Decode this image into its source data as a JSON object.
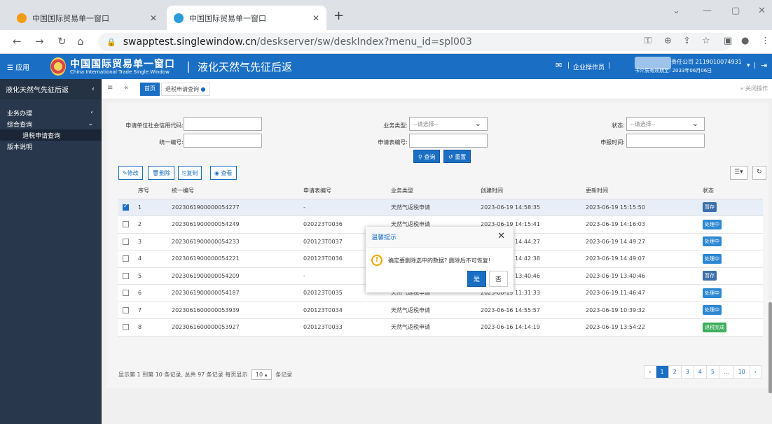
{
  "browser": {
    "tabs": [
      {
        "title": "中国国际贸易单一窗口",
        "active": false
      },
      {
        "title": "中国国际贸易单一窗口",
        "active": true
      }
    ],
    "url_host": "swapptest.singlewindow.cn",
    "url_path": "/deskserver/sw/deskIndex?menu_id=spl003"
  },
  "header": {
    "menu_label": "☰ 应用",
    "logo_cn": "中国国际贸易单一窗口",
    "logo_en": "China International Trade Single Window",
    "system_title": "液化天然气先征后返",
    "role": "企业操作员",
    "company": "责任公司 2119010074931",
    "cert_expiry": "卡介质有效期至: 2033年06月06日"
  },
  "sidebar": {
    "title": "液化天然气先征后返",
    "items": [
      {
        "label": "业务办理",
        "arrow": "‹"
      },
      {
        "label": "综合查询",
        "arrow": "⌄"
      },
      {
        "label": "退税申请查询",
        "arrow": ""
      },
      {
        "label": "版本说明",
        "arrow": ""
      }
    ]
  },
  "content_tabs": {
    "home": "首页",
    "current": "退税申请查询",
    "close_ops": "关闭操作"
  },
  "search": {
    "credit_code_label": "申请单位社会信用代码:",
    "unified_no_label": "统一编号:",
    "biz_type_label": "业务类型:",
    "biz_type_value": "--请选择--",
    "app_no_label": "申请表编号:",
    "status_label": "状态:",
    "status_value": "--请选择--",
    "report_time_label": "申报时间:",
    "query_btn": "查询",
    "reset_btn": "重置"
  },
  "toolbar": {
    "edit": "修改",
    "delete": "删除",
    "copy": "复制",
    "view": "查看"
  },
  "table": {
    "columns": [
      "序号",
      "统一编号",
      "申请表编号",
      "业务类型",
      "创建时间",
      "更新时间",
      "状态"
    ],
    "rows": [
      {
        "idx": "1",
        "uno": "2023061900000054277",
        "app": "-",
        "type": "天然气返税申请",
        "created": "2023-06-19 14:58:35",
        "updated": "2023-06-19 15:15:50",
        "status": "暂存",
        "status_color": "#3c6fa8",
        "checked": true
      },
      {
        "idx": "2",
        "uno": "2023061900000054249",
        "app": "020223T0036",
        "type": "天然气返税申请",
        "created": "2023-06-19 14:15:41",
        "updated": "2023-06-19 14:16:03",
        "status": "处理中",
        "status_color": "#2d87d2",
        "checked": false
      },
      {
        "idx": "3",
        "uno": "2023061900000054233",
        "app": "020123T0037",
        "type": "天然气返税申请",
        "created": "2023-06-19 14:44:27",
        "updated": "2023-06-19 14:49:27",
        "status": "处理中",
        "status_color": "#2d87d2",
        "checked": false
      },
      {
        "idx": "4",
        "uno": "2023061900000054221",
        "app": "020123T0036",
        "type": "天然气返税申请",
        "created": "2023-06-19 14:42:38",
        "updated": "2023-06-19 14:49:07",
        "status": "处理中",
        "status_color": "#2d87d2",
        "checked": false
      },
      {
        "idx": "5",
        "uno": "2023061900000054209",
        "app": "-",
        "type": "天然气返税申请",
        "created": "2023-06-19 13:40:46",
        "updated": "2023-06-19 13:40:46",
        "status": "暂存",
        "status_color": "#3c6fa8",
        "checked": false
      },
      {
        "idx": "6",
        "uno": "2023061900000054187",
        "app": "020123T0035",
        "type": "天然气返税申请",
        "created": "2023-06-19 11:31:33",
        "updated": "2023-06-19 11:46:47",
        "status": "处理中",
        "status_color": "#2d87d2",
        "checked": false
      },
      {
        "idx": "7",
        "uno": "2023061600000053939",
        "app": "020123T0034",
        "type": "天然气返税申请",
        "created": "2023-06-16 14:55:57",
        "updated": "2023-06-19 10:39:32",
        "status": "处理中",
        "status_color": "#2d87d2",
        "checked": false
      },
      {
        "idx": "8",
        "uno": "2023061600000053927",
        "app": "020123T0033",
        "type": "天然气返税申请",
        "created": "2023-06-16 14:14:19",
        "updated": "2023-06-19 13:54:22",
        "status": "退税完成",
        "status_color": "#3cae5c",
        "checked": false
      }
    ]
  },
  "pagination": {
    "info_prefix": "显示第 1 到第 10 条记录, 总共 97 条记录 每页显示",
    "page_size": "10 ▴",
    "info_suffix": "条记录",
    "pages": [
      "‹",
      "1",
      "2",
      "3",
      "4",
      "5",
      "...",
      "10",
      "›"
    ]
  },
  "modal": {
    "title": "温馨提示",
    "message": "确定要删除选中的数据? 删除后不可恢复!",
    "yes": "是",
    "no": "否"
  }
}
